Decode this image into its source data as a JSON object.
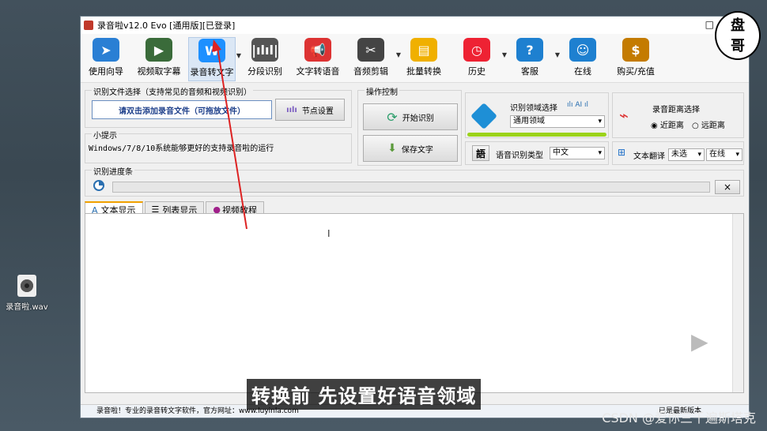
{
  "desktop": {
    "file_label": "录音啦.wav"
  },
  "window": {
    "title": "录音啦v12.0 Evo [通用版][已登录]",
    "minimize_glyph": "□"
  },
  "toolbar": [
    {
      "label": "使用向导",
      "icon": "cursor-icon",
      "color": "#2a7fd4"
    },
    {
      "label": "视频取字幕",
      "icon": "film-icon",
      "color": "#3a6b3a"
    },
    {
      "label": "录音转文字",
      "icon": "w-icon",
      "color": "#1e90ff"
    },
    {
      "label": "分段识别",
      "icon": "waveform-icon",
      "color": "#555555"
    },
    {
      "label": "文字转语音",
      "icon": "megaphone-icon",
      "color": "#d33"
    },
    {
      "label": "音频剪辑",
      "icon": "scissors-icon",
      "color": "#444"
    },
    {
      "label": "批量转换",
      "icon": "folder-icon",
      "color": "#f0b000"
    },
    {
      "label": "历史",
      "icon": "history-icon",
      "color": "#e23"
    },
    {
      "label": "客服",
      "icon": "help-icon",
      "color": "#1e80d0"
    },
    {
      "label": "在线",
      "icon": "user-icon",
      "color": "#1e80d0"
    },
    {
      "label": "购买/充值",
      "icon": "coin-icon",
      "color": "#c47b00"
    }
  ],
  "file_select": {
    "legend": "识别文件选择（支持常见的音频和视频识别）",
    "add_button": "请双击添加录音文件（可拖放文件）",
    "node_button": "节点设置"
  },
  "tip": {
    "legend": "小提示",
    "text": "Windows/7/8/10系统能够更好的支持录音啦的运行"
  },
  "operation": {
    "legend": "操作控制",
    "start": "开始识别",
    "save": "保存文字"
  },
  "domain": {
    "label": "识别领域选择",
    "value": "通用领域"
  },
  "distance": {
    "label": "录音距离选择",
    "near": "近距离",
    "far": "远距离"
  },
  "language": {
    "label": "语音识别类型",
    "value": "中文",
    "icon_text": "語"
  },
  "translate": {
    "label": "文本翻译",
    "value": "未选",
    "mode": "在线"
  },
  "progress": {
    "legend": "识别进度条",
    "close": "×"
  },
  "tabs": [
    "文本显示",
    "列表显示",
    "视频教程"
  ],
  "status": {
    "text": "录音啦！专业的录音转文字软件，官方网址：www.luyinla.com"
  },
  "overlay": {
    "logo_top": "盘",
    "logo_bottom": "哥",
    "subtitle": "转换前 先设置好语音领域",
    "watermark": "CSDN @爱你三千遍斯塔克",
    "status_right": "已是最新版本"
  }
}
